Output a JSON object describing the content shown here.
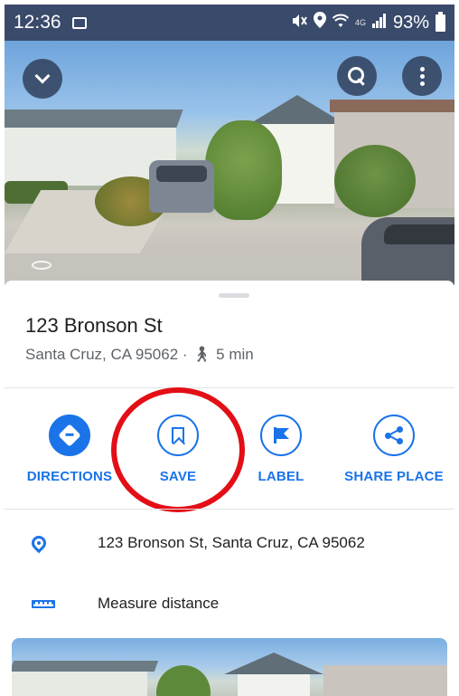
{
  "status_bar": {
    "time": "12:36",
    "network": "4G",
    "battery": "93%"
  },
  "header": {
    "collapse_icon": "chevron-down-icon",
    "search_icon": "search-icon",
    "more_icon": "more-vert-icon"
  },
  "place": {
    "title": "123 Bronson St",
    "subtitle": "Santa Cruz, CA 95062 ·",
    "walk_time": "5 min"
  },
  "actions": [
    {
      "label": "DIRECTIONS",
      "icon": "directions-icon"
    },
    {
      "label": "SAVE",
      "icon": "bookmark-icon"
    },
    {
      "label": "LABEL",
      "icon": "flag-icon"
    },
    {
      "label": "SHARE PLACE",
      "icon": "share-icon"
    }
  ],
  "info_rows": [
    {
      "text": "123 Bronson St, Santa Cruz, CA 95062",
      "icon": "location-pin-icon"
    },
    {
      "text": "Measure distance",
      "icon": "ruler-icon"
    }
  ],
  "colors": {
    "accent": "#1a73e8",
    "annotation": "#e30e16",
    "status_bar": "#3a4a6b"
  }
}
